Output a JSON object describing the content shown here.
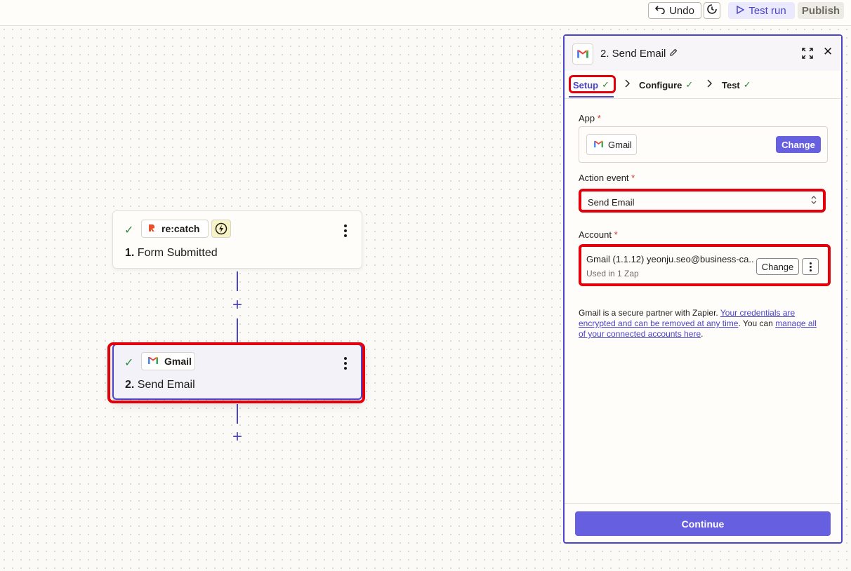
{
  "toolbar": {
    "undo_label": "Undo",
    "test_run_label": "Test run",
    "publish_label": "Publish"
  },
  "canvas": {
    "steps": [
      {
        "app_name": "re:catch",
        "number": "1.",
        "title": "Form Submitted",
        "status": "complete"
      },
      {
        "app_name": "Gmail",
        "number": "2.",
        "title": "Send Email",
        "status": "complete",
        "selected": true
      }
    ]
  },
  "panel": {
    "title": "2. Send Email",
    "tabs": [
      {
        "label": "Setup",
        "complete": true,
        "active": true
      },
      {
        "label": "Configure",
        "complete": true
      },
      {
        "label": "Test",
        "complete": true
      }
    ],
    "app": {
      "label": "App",
      "required_mark": "*",
      "value": "Gmail",
      "change_label": "Change"
    },
    "action_event": {
      "label": "Action event",
      "required_mark": "*",
      "value": "Send Email"
    },
    "account": {
      "label": "Account",
      "required_mark": "*",
      "value": "Gmail (1.1.12) yeonju.seo@business-ca...",
      "usage": "Used in 1 Zap",
      "change_label": "Change"
    },
    "info": {
      "text_before": "Gmail is a secure partner with Zapier. ",
      "link1": "Your credentials are encrypted and can be removed at any time",
      "text_middle": ". You can ",
      "link2": "manage all of your connected accounts here",
      "text_after": "."
    },
    "continue_label": "Continue"
  },
  "colors": {
    "accent": "#4a44c9",
    "primary_button": "#6660e0",
    "highlight": "#e3000b",
    "success": "#2f8a3e",
    "recatch_brand": "#e5532d"
  }
}
